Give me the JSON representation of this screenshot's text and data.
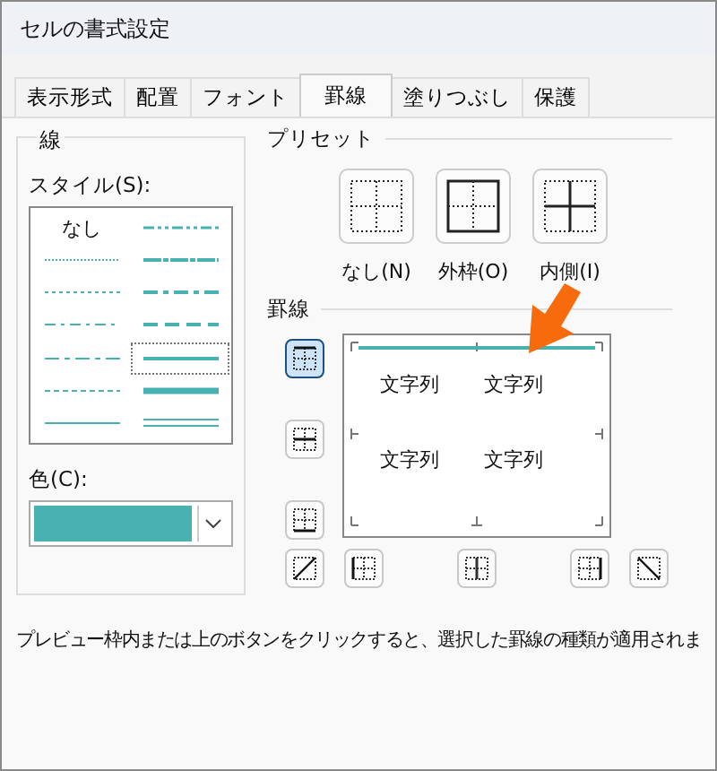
{
  "window": {
    "title": "セルの書式設定"
  },
  "tabs": [
    {
      "label": "表示形式",
      "selected": false
    },
    {
      "label": "配置",
      "selected": false
    },
    {
      "label": "フォント",
      "selected": false
    },
    {
      "label": "罫線",
      "selected": true
    },
    {
      "label": "塗りつぶし",
      "selected": false
    },
    {
      "label": "保護",
      "selected": false
    }
  ],
  "line": {
    "title": "線",
    "style_label": "スタイル(S):",
    "styles": [
      {
        "kind": "none",
        "label": "なし",
        "selected": false
      },
      {
        "kind": "dash-dot-dot",
        "selected": false
      },
      {
        "kind": "hair",
        "selected": false
      },
      {
        "kind": "slant-dash-dot",
        "selected": false
      },
      {
        "kind": "dotted",
        "selected": false
      },
      {
        "kind": "medium-dash-dot",
        "selected": false
      },
      {
        "kind": "dash-dot",
        "selected": false
      },
      {
        "kind": "medium-dashed",
        "selected": false
      },
      {
        "kind": "dash-dot-long",
        "selected": false
      },
      {
        "kind": "medium",
        "selected": true
      },
      {
        "kind": "dashed",
        "selected": false
      },
      {
        "kind": "thick",
        "selected": false
      },
      {
        "kind": "thin",
        "selected": false
      },
      {
        "kind": "double",
        "selected": false
      }
    ],
    "color_label": "色(C):",
    "color": "#48b1b1"
  },
  "preset": {
    "title": "プリセット",
    "buttons": [
      {
        "kind": "none",
        "label": "なし(N)"
      },
      {
        "kind": "outline",
        "label": "外枠(O)"
      },
      {
        "kind": "inside",
        "label": "内側(I)"
      }
    ]
  },
  "border": {
    "title": "罫線",
    "buttons": [
      {
        "kind": "top",
        "selected": true
      },
      {
        "kind": "middle",
        "selected": false
      },
      {
        "kind": "bottom",
        "selected": false
      },
      {
        "kind": "diag-up",
        "selected": false
      },
      {
        "kind": "left",
        "selected": false
      },
      {
        "kind": "center",
        "selected": false
      },
      {
        "kind": "right",
        "selected": false
      },
      {
        "kind": "diag-down",
        "selected": false
      }
    ],
    "preview_texts": [
      "文字列",
      "文字列",
      "文字列",
      "文字列"
    ]
  },
  "hint": "プレビュー枠内または上のボタンをクリックすると、選択した罫線の種類が適用されま"
}
